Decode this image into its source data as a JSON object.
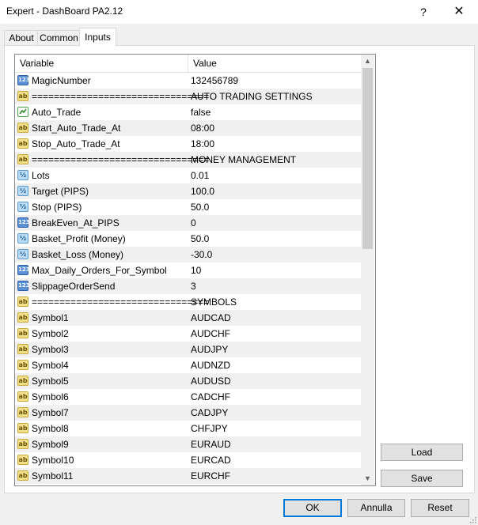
{
  "window": {
    "title": "Expert - DashBoard PA2.12",
    "help_glyph": "?",
    "close_glyph": "✕"
  },
  "tabs": [
    {
      "label": "About",
      "active": false
    },
    {
      "label": "Common",
      "active": false
    },
    {
      "label": "Inputs",
      "active": true
    }
  ],
  "grid": {
    "col_variable": "Variable",
    "col_value": "Value",
    "rows": [
      {
        "type": "int",
        "variable": "MagicNumber",
        "value": "132456789"
      },
      {
        "type": "string",
        "variable": "================================",
        "value": "AUTO TRADING SETTINGS"
      },
      {
        "type": "bool",
        "variable": "Auto_Trade",
        "value": "false"
      },
      {
        "type": "string",
        "variable": "Start_Auto_Trade_At",
        "value": "08:00"
      },
      {
        "type": "string",
        "variable": "Stop_Auto_Trade_At",
        "value": "18:00"
      },
      {
        "type": "string",
        "variable": "================================",
        "value": "MONEY MANAGEMENT"
      },
      {
        "type": "double",
        "variable": "Lots",
        "value": "0.01"
      },
      {
        "type": "double",
        "variable": "Target (PIPS)",
        "value": "100.0"
      },
      {
        "type": "double",
        "variable": "Stop (PIPS)",
        "value": "50.0"
      },
      {
        "type": "int",
        "variable": "BreakEven_At_PIPS",
        "value": "0"
      },
      {
        "type": "double",
        "variable": "Basket_Profit (Money)",
        "value": "50.0"
      },
      {
        "type": "double",
        "variable": "Basket_Loss (Money)",
        "value": "-30.0"
      },
      {
        "type": "int",
        "variable": "Max_Daily_Orders_For_Symbol",
        "value": "10"
      },
      {
        "type": "int",
        "variable": "SlippageOrderSend",
        "value": "3"
      },
      {
        "type": "string",
        "variable": "================================",
        "value": "SYMBOLS"
      },
      {
        "type": "string",
        "variable": "Symbol1",
        "value": "AUDCAD"
      },
      {
        "type": "string",
        "variable": "Symbol2",
        "value": "AUDCHF"
      },
      {
        "type": "string",
        "variable": "Symbol3",
        "value": "AUDJPY"
      },
      {
        "type": "string",
        "variable": "Symbol4",
        "value": "AUDNZD"
      },
      {
        "type": "string",
        "variable": "Symbol5",
        "value": "AUDUSD"
      },
      {
        "type": "string",
        "variable": "Symbol6",
        "value": "CADCHF"
      },
      {
        "type": "string",
        "variable": "Symbol7",
        "value": "CADJPY"
      },
      {
        "type": "string",
        "variable": "Symbol8",
        "value": "CHFJPY"
      },
      {
        "type": "string",
        "variable": "Symbol9",
        "value": "EURAUD"
      },
      {
        "type": "string",
        "variable": "Symbol10",
        "value": "EURCAD"
      },
      {
        "type": "string",
        "variable": "Symbol11",
        "value": "EURCHF"
      }
    ]
  },
  "buttons": {
    "load": "Load",
    "save": "Save",
    "ok": "OK",
    "cancel": "Annulla",
    "reset": "Reset"
  },
  "icons": {
    "int": {
      "name": "integer-type-icon",
      "glyph": "123"
    },
    "string": {
      "name": "string-type-icon",
      "glyph": "ab"
    },
    "double": {
      "name": "double-type-icon",
      "glyph": "½"
    },
    "bool": {
      "name": "boolean-type-icon",
      "glyph": ""
    }
  }
}
